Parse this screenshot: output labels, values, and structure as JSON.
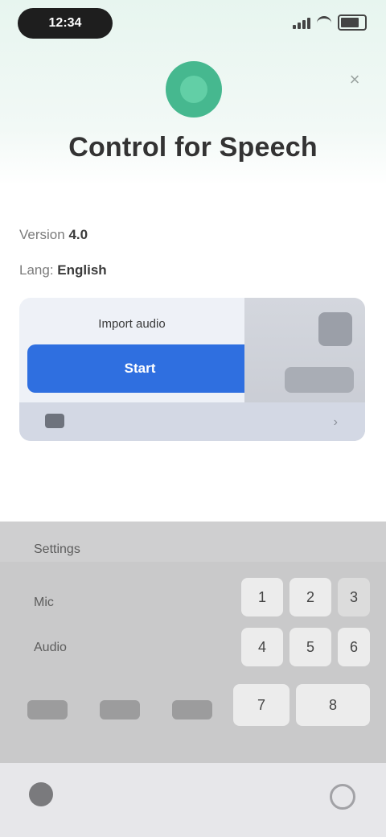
{
  "status_bar": {
    "time": "12:34",
    "signal_icon": "signal-icon",
    "wifi_icon": "wifi-icon",
    "battery_icon": "battery-icon"
  },
  "header": {
    "logo_icon": "app-logo-icon",
    "close_label": "×",
    "title": "Control for Speech"
  },
  "details": {
    "line1_label": "Version",
    "line1_value": "4.0",
    "line2_label": "Lang:",
    "line2_value": "English"
  },
  "card": {
    "label": "Import audio",
    "primary_button": "Start",
    "footer_icon": "file-icon",
    "footer_arrow": "›"
  },
  "keyboard": {
    "row1": "Settings",
    "row2": "Mic",
    "row3": "Audio",
    "keys": [
      "1",
      "2",
      "3",
      "4",
      "5",
      "6",
      "7",
      "8"
    ]
  },
  "bottom_bar": {
    "left_icon": "home-icon",
    "right_icon": "help-icon"
  },
  "colors": {
    "accent": "#2f6fe0",
    "brand": "#46b88f"
  }
}
